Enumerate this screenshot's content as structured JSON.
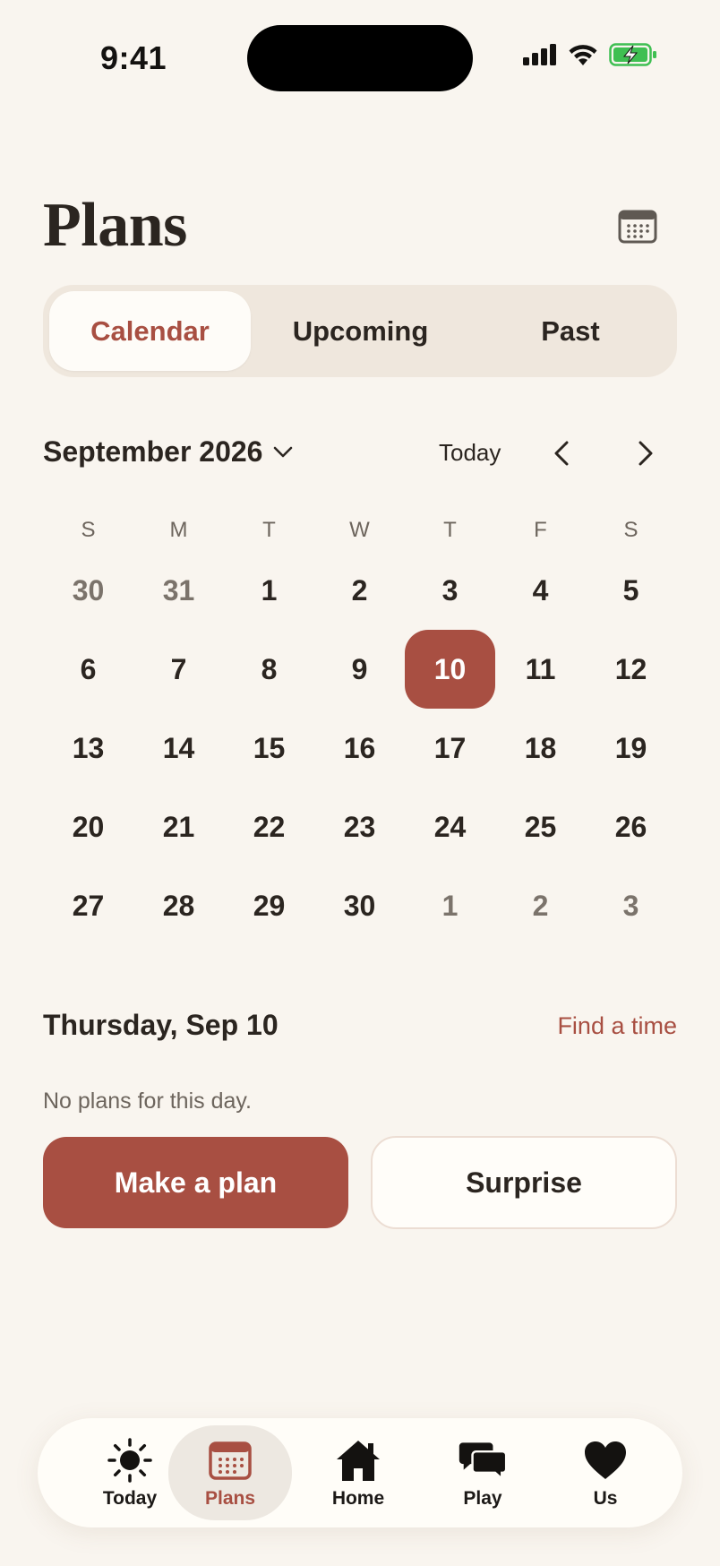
{
  "status_bar": {
    "time": "9:41",
    "icons": [
      "signal-icon",
      "wifi-icon",
      "battery-charging-icon"
    ],
    "battery_color": "#3fbf52"
  },
  "header": {
    "title": "Plans",
    "calendar_icon": "calendar-icon"
  },
  "segmented": {
    "tabs": [
      {
        "label": "Calendar",
        "active": true
      },
      {
        "label": "Upcoming",
        "active": false
      },
      {
        "label": "Past",
        "active": false
      }
    ]
  },
  "calendar": {
    "month_label": "September 2026",
    "today_label": "Today",
    "weekdays": [
      "S",
      "M",
      "T",
      "W",
      "T",
      "F",
      "S"
    ],
    "days": [
      {
        "n": "30",
        "muted": true
      },
      {
        "n": "31",
        "muted": true
      },
      {
        "n": "1"
      },
      {
        "n": "2"
      },
      {
        "n": "3"
      },
      {
        "n": "4"
      },
      {
        "n": "5"
      },
      {
        "n": "6"
      },
      {
        "n": "7"
      },
      {
        "n": "8"
      },
      {
        "n": "9"
      },
      {
        "n": "10",
        "selected": true
      },
      {
        "n": "11"
      },
      {
        "n": "12"
      },
      {
        "n": "13"
      },
      {
        "n": "14"
      },
      {
        "n": "15"
      },
      {
        "n": "16"
      },
      {
        "n": "17"
      },
      {
        "n": "18"
      },
      {
        "n": "19"
      },
      {
        "n": "20"
      },
      {
        "n": "21"
      },
      {
        "n": "22"
      },
      {
        "n": "23"
      },
      {
        "n": "24"
      },
      {
        "n": "25"
      },
      {
        "n": "26"
      },
      {
        "n": "27"
      },
      {
        "n": "28"
      },
      {
        "n": "29"
      },
      {
        "n": "30"
      },
      {
        "n": "1",
        "muted": true
      },
      {
        "n": "2",
        "muted": true
      },
      {
        "n": "3",
        "muted": true
      }
    ]
  },
  "day_detail": {
    "date_label": "Thursday, Sep 10",
    "find_time_label": "Find a time",
    "empty_text": "No plans for this day.",
    "primary_button": "Make a plan",
    "secondary_button": "Surprise"
  },
  "tabbar": {
    "items": [
      {
        "label": "Today",
        "icon": "sun-icon",
        "active": false
      },
      {
        "label": "Plans",
        "icon": "calendar-icon",
        "active": true
      },
      {
        "label": "Home",
        "icon": "house-icon",
        "active": false
      },
      {
        "label": "Play",
        "icon": "chat-bubbles-icon",
        "active": false
      },
      {
        "label": "Us",
        "icon": "heart-icon",
        "active": false
      }
    ]
  },
  "colors": {
    "accent": "#a84f42",
    "background": "#f9f5ef",
    "segmented_bg": "#efe7dd"
  }
}
